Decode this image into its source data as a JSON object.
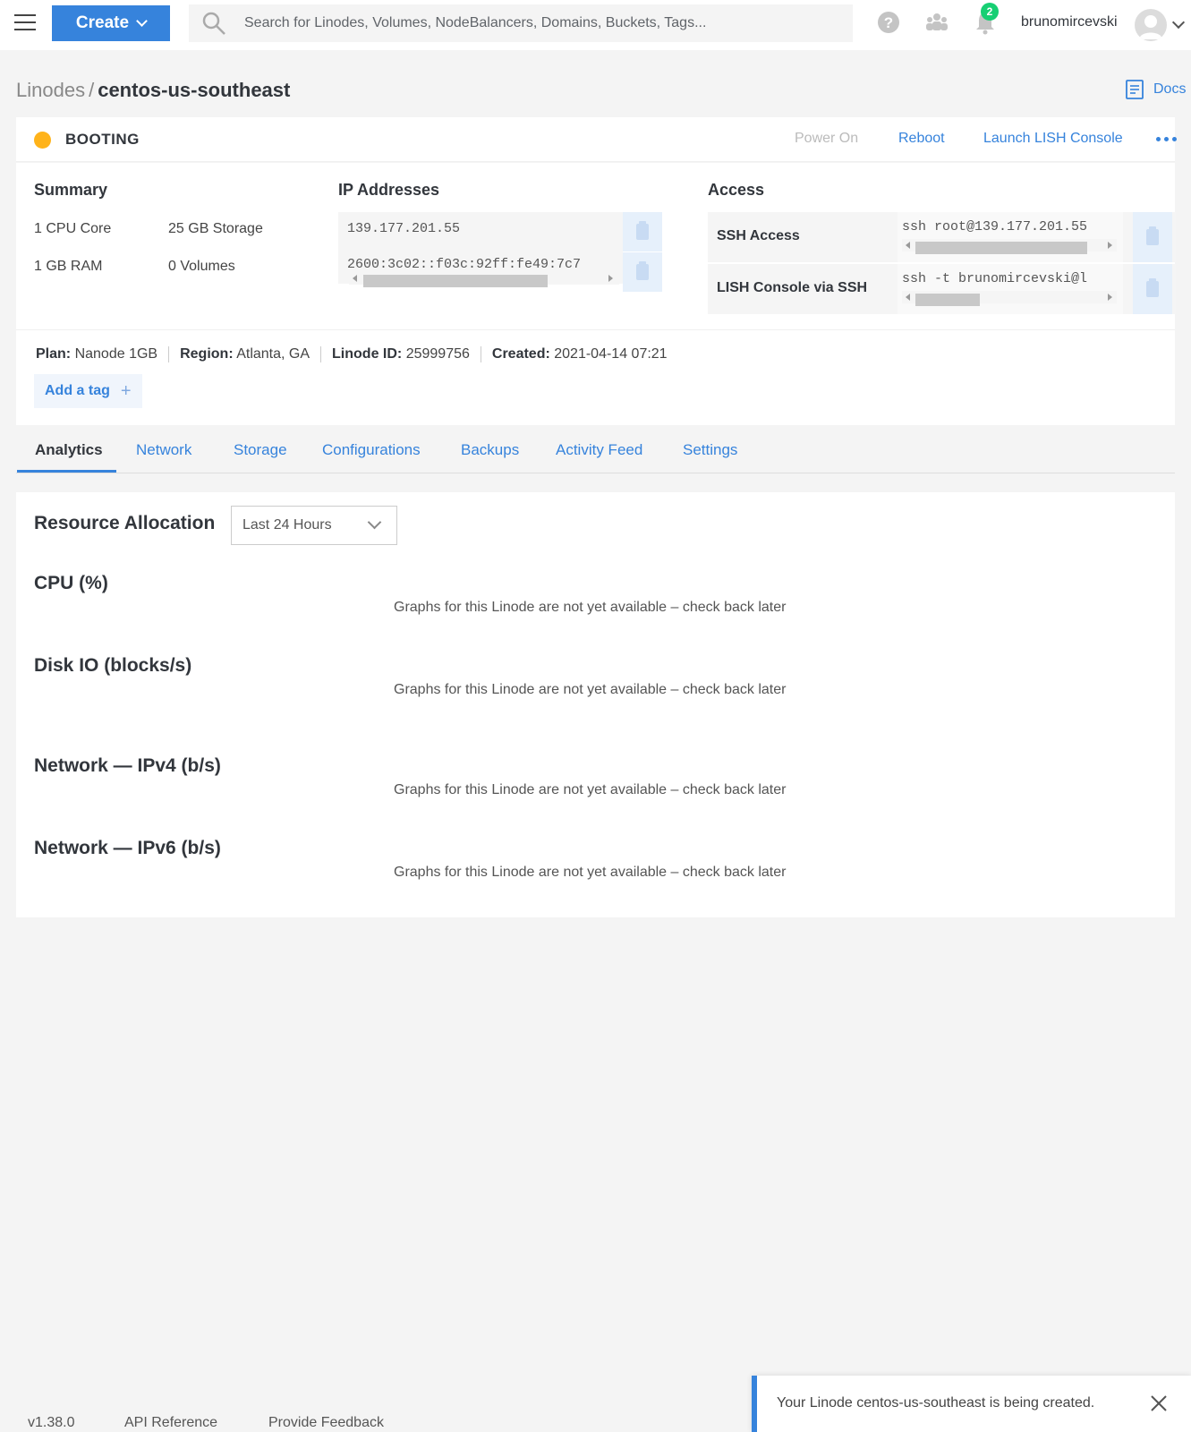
{
  "topbar": {
    "create_label": "Create",
    "search_placeholder": "Search for Linodes, Volumes, NodeBalancers, Domains, Buckets, Tags...",
    "notification_count": "2",
    "username": "brunomircevski"
  },
  "breadcrumb": {
    "parent": "Linodes",
    "separator": "/",
    "current": "centos-us-southeast",
    "docs_label": "Docs"
  },
  "status": {
    "label": "BOOTING",
    "color": "#ffb31a",
    "actions": {
      "power_on": "Power On",
      "reboot": "Reboot",
      "launch_lish": "Launch LISH Console"
    }
  },
  "summary": {
    "title": "Summary",
    "cpu": "1 CPU Core",
    "storage": "25 GB Storage",
    "ram": "1 GB RAM",
    "volumes": "0 Volumes"
  },
  "ip_addresses": {
    "title": "IP Addresses",
    "ipv4": "139.177.201.55",
    "ipv6": "2600:3c02::f03c:92ff:fe49:7c7"
  },
  "access": {
    "title": "Access",
    "ssh_label": "SSH Access",
    "ssh_command": "ssh root@139.177.201.55",
    "lish_label": "LISH Console via SSH",
    "lish_command": "ssh -t brunomircevski@l"
  },
  "meta": {
    "plan_label": "Plan:",
    "plan_value": "Nanode 1GB",
    "region_label": "Region:",
    "region_value": "Atlanta, GA",
    "id_label": "Linode ID:",
    "id_value": "25999756",
    "created_label": "Created:",
    "created_value": "2021-04-14 07:21",
    "add_tag": "Add a tag",
    "add_tag_plus": "+"
  },
  "tabs": [
    "Analytics",
    "Network",
    "Storage",
    "Configurations",
    "Backups",
    "Activity Feed",
    "Settings"
  ],
  "analytics": {
    "title": "Resource Allocation",
    "range": "Last 24 Hours",
    "graphs": [
      {
        "title": "CPU (%)",
        "message": "Graphs for this Linode are not yet available – check back later"
      },
      {
        "title": "Disk IO (blocks/s)",
        "message": "Graphs for this Linode are not yet available – check back later"
      },
      {
        "title": "Network — IPv4 (b/s)",
        "message": "Graphs for this Linode are not yet available – check back later"
      },
      {
        "title": "Network — IPv6 (b/s)",
        "message": "Graphs for this Linode are not yet available – check back later"
      }
    ]
  },
  "footer": {
    "version": "v1.38.0",
    "api_reference": "API Reference",
    "feedback": "Provide Feedback"
  },
  "toast": {
    "message": "Your Linode centos-us-southeast is being created."
  },
  "colors": {
    "accent": "#3683dc",
    "booting": "#ffb31a",
    "badge": "#17cf73"
  }
}
